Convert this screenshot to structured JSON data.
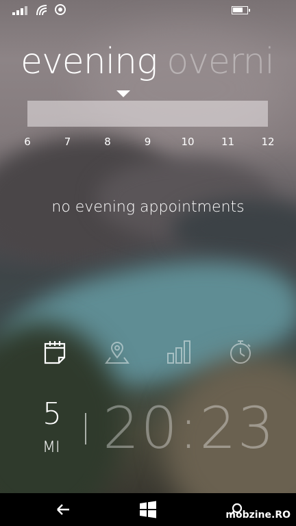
{
  "status_bar": {
    "icons": [
      "signal-icon",
      "wifi-icon",
      "record-icon",
      "battery-icon"
    ]
  },
  "pivot": {
    "active": "evening",
    "next": "overni"
  },
  "timeline": {
    "hours": [
      "6",
      "7",
      "8",
      "9",
      "10",
      "11",
      "12"
    ]
  },
  "content": {
    "empty_message": "no evening appointments"
  },
  "app_bar": {
    "buttons": [
      "calendar-icon",
      "map-pin-icon",
      "bar-chart-icon",
      "stopwatch-icon"
    ]
  },
  "datetime": {
    "day": "5",
    "day_of_week": "MI",
    "time": "20:23"
  },
  "nav_bar": {
    "buttons": [
      "back-icon",
      "windows-icon",
      "search-icon"
    ]
  },
  "watermark": "mobzine.RO",
  "colors": {
    "text": "#ffffff",
    "inactive_text": "rgba(255,255,255,0.35)",
    "nav_background": "#000000"
  }
}
